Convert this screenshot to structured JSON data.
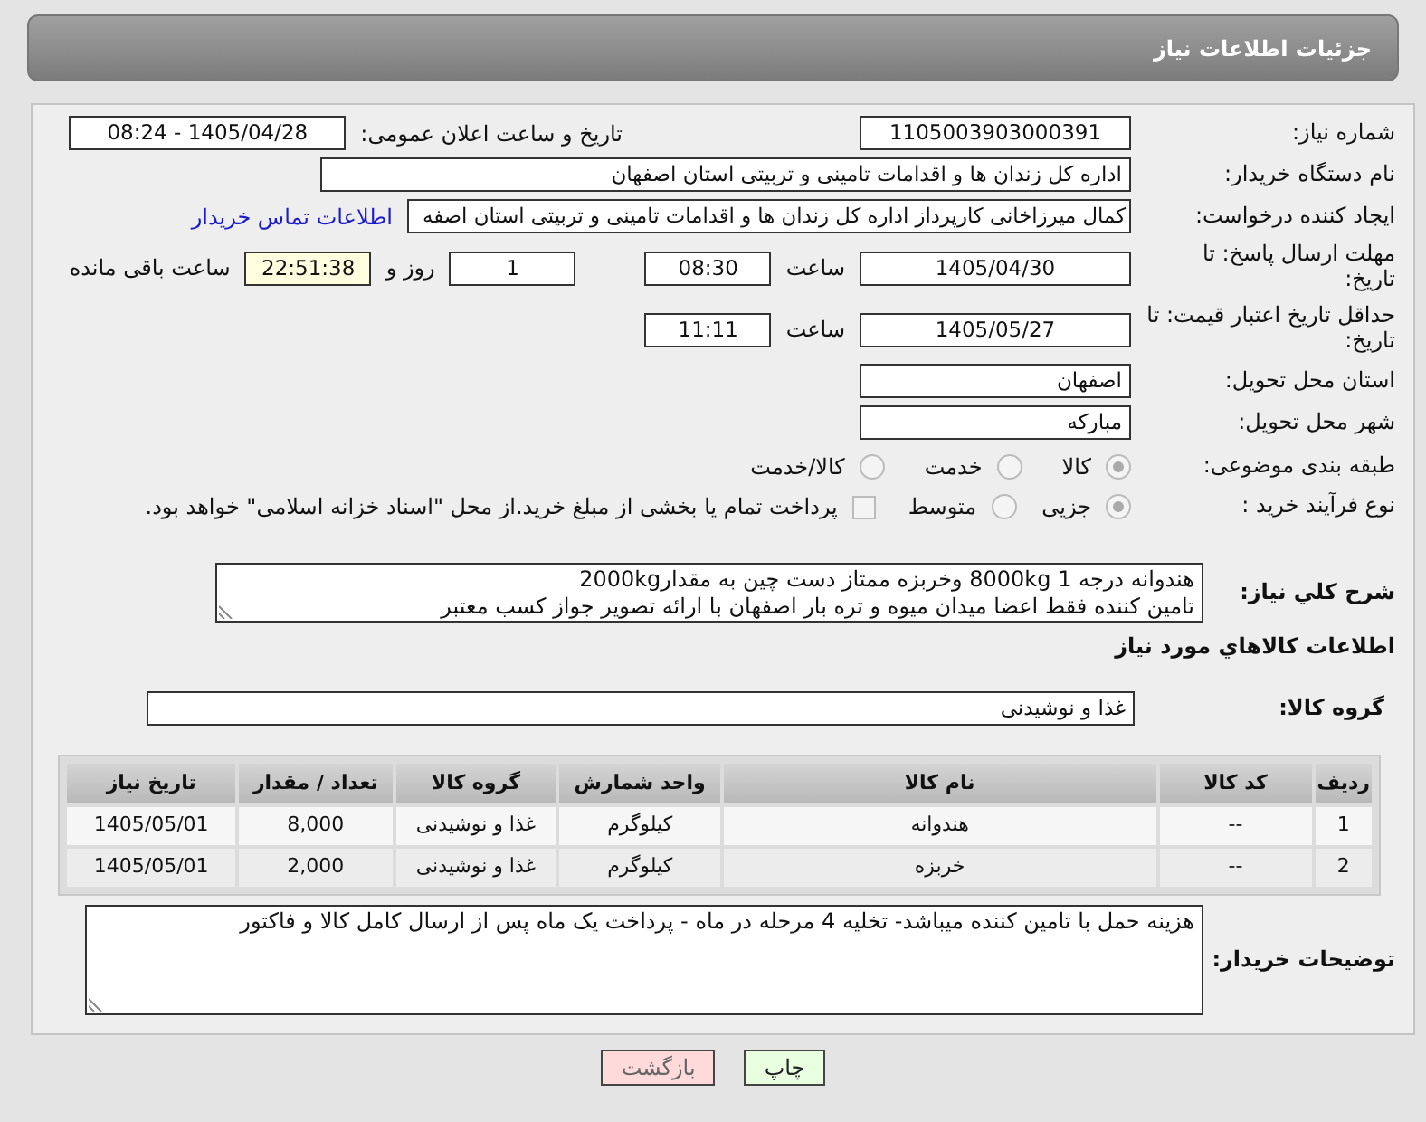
{
  "header": {
    "title": "جزئیات اطلاعات نیاز"
  },
  "need_number": {
    "label": "شماره نیاز:",
    "value": "1105003903000391"
  },
  "announce": {
    "label": "تاریخ و ساعت اعلان عمومی:",
    "value": "1405/04/28 - 08:24"
  },
  "buyer_org": {
    "label": "نام دستگاه خریدار:",
    "value": "اداره کل زندان ها و اقدامات تامینی و تربیتی استان اصفهان"
  },
  "requester": {
    "label": "ایجاد کننده درخواست:",
    "value": "کمال میرزاخانی کارپرداز اداره کل زندان ها و اقدامات تامینی و تربیتی استان اصفه",
    "link": "اطلاعات تماس خریدار"
  },
  "deadline": {
    "label": "مهلت ارسال پاسخ: تا تاریخ:",
    "date": "1405/04/30",
    "time_label": "ساعت",
    "time": "08:30",
    "days": "1",
    "days_label": "روز و",
    "remaining": "22:51:38",
    "remaining_label": "ساعت باقی مانده"
  },
  "validity": {
    "label": "حداقل تاریخ اعتبار قیمت: تا تاریخ:",
    "date": "1405/05/27",
    "time_label": "ساعت",
    "time": "11:11"
  },
  "province": {
    "label": "استان محل تحویل:",
    "value": "اصفهان"
  },
  "city": {
    "label": "شهر محل تحویل:",
    "value": "مبارکه"
  },
  "category": {
    "label": "طبقه بندی موضوعی:",
    "options": [
      {
        "label": "کالا",
        "selected": true
      },
      {
        "label": "خدمت",
        "selected": false
      },
      {
        "label": "کالا/خدمت",
        "selected": false
      }
    ]
  },
  "purchase_type": {
    "label": "نوع فرآیند خرید :",
    "options": [
      {
        "label": "جزیی",
        "selected": true
      },
      {
        "label": "متوسط",
        "selected": false
      }
    ],
    "treasury": {
      "label": "پرداخت تمام یا بخشی از مبلغ خرید.از محل \"اسناد خزانه اسلامی\" خواهد بود.",
      "checked": false
    }
  },
  "description": {
    "label": "شرح کلي نياز:",
    "lines": [
      "هندوانه درجه 1 8000kg وخربزه ممتاز دست چین به مقدار2000kg",
      "تامین کننده فقط اعضا میدان میوه و تره بار اصفهان با ارائه تصویر جواز کسب معتبر"
    ]
  },
  "goods_title": "اطلاعات کالاهاي مورد نياز",
  "goods_group": {
    "label": "گروه کالا:",
    "value": "غذا و نوشیدنی"
  },
  "table": {
    "columns": [
      "ردیف",
      "کد کالا",
      "نام کالا",
      "واحد شمارش",
      "گروه کالا",
      "تعداد / مقدار",
      "تاریخ نیاز"
    ],
    "rows": [
      [
        "1",
        "--",
        "هندوانه",
        "کیلوگرم",
        "غذا و نوشیدنی",
        "8,000",
        "1405/05/01"
      ],
      [
        "2",
        "--",
        "خربزه",
        "کیلوگرم",
        "غذا و نوشیدنی",
        "2,000",
        "1405/05/01"
      ]
    ]
  },
  "buyer_notes": {
    "label": "توضیحات خریدار:",
    "value": "هزینه حمل با تامین کننده میباشد- تخلیه 4 مرحله در ماه - پرداخت یک ماه پس از ارسال کامل کالا و فاکتور"
  },
  "buttons": [
    {
      "label": "چاپ",
      "kind": "print"
    },
    {
      "label": "بازگشت",
      "kind": "back"
    }
  ]
}
